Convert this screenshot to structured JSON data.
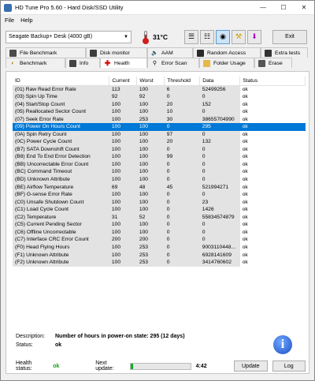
{
  "window": {
    "title": "HD Tune Pro 5.60 - Hard Disk/SSD Utility"
  },
  "menu": {
    "file": "File",
    "help": "Help"
  },
  "toolbar": {
    "drive": "Seagate Backup+  Desk (4000 gB)",
    "temperature": "31°C",
    "exit": "Exit"
  },
  "tabs_top": [
    "File Benchmark",
    "Disk monitor",
    "AAM",
    "Random Access",
    "Extra tests"
  ],
  "tabs_bottom": [
    "Benchmark",
    "Info",
    "Health",
    "Error Scan",
    "Folder Usage",
    "Erase"
  ],
  "table": {
    "headers": [
      "ID",
      "Current",
      "Worst",
      "Threshold",
      "Data",
      "Status"
    ],
    "rows": [
      [
        "(01) Raw Read Error Rate",
        "113",
        "100",
        "6",
        "52499256",
        "ok"
      ],
      [
        "(03) Spin Up Time",
        "92",
        "92",
        "0",
        "0",
        "ok"
      ],
      [
        "(04) Start/Stop Count",
        "100",
        "100",
        "20",
        "152",
        "ok"
      ],
      [
        "(05) Reallocated Sector Count",
        "100",
        "100",
        "10",
        "0",
        "ok"
      ],
      [
        "(07) Seek Error Rate",
        "100",
        "253",
        "30",
        "38655704990",
        "ok"
      ],
      [
        "(09) Power On Hours Count",
        "100",
        "100",
        "0",
        "295",
        "ok"
      ],
      [
        "(0A) Spin Retry Count",
        "100",
        "100",
        "97",
        "0",
        "ok"
      ],
      [
        "(0C) Power Cycle Count",
        "100",
        "100",
        "20",
        "132",
        "ok"
      ],
      [
        "(B7) SATA Downshift Count",
        "100",
        "100",
        "0",
        "0",
        "ok"
      ],
      [
        "(B8) End To End Error Detection",
        "100",
        "100",
        "99",
        "0",
        "ok"
      ],
      [
        "(BB) Uncorrectable Error Count",
        "100",
        "100",
        "0",
        "0",
        "ok"
      ],
      [
        "(BC) Command Timeout",
        "100",
        "100",
        "0",
        "0",
        "ok"
      ],
      [
        "(BD) Unknown Attribute",
        "100",
        "100",
        "0",
        "0",
        "ok"
      ],
      [
        "(BE) Airflow Temperature",
        "69",
        "48",
        "45",
        "521994271",
        "ok"
      ],
      [
        "(BF) G-sense Error Rate",
        "100",
        "100",
        "0",
        "0",
        "ok"
      ],
      [
        "(C0) Unsafe Shutdown Count",
        "100",
        "100",
        "0",
        "23",
        "ok"
      ],
      [
        "(C1) Load Cycle Count",
        "100",
        "100",
        "0",
        "1426",
        "ok"
      ],
      [
        "(C2) Temperature",
        "31",
        "52",
        "0",
        "55834574879",
        "ok"
      ],
      [
        "(C5) Current Pending Sector",
        "100",
        "100",
        "0",
        "0",
        "ok"
      ],
      [
        "(C6) Offline Uncorrectable",
        "100",
        "100",
        "0",
        "0",
        "ok"
      ],
      [
        "(C7) Interface CRC Error Count",
        "200",
        "200",
        "0",
        "0",
        "ok"
      ],
      [
        "(F0) Head Flying Hours",
        "100",
        "253",
        "0",
        "9003110448...",
        "ok"
      ],
      [
        "(F1) Unknown Attribute",
        "100",
        "253",
        "0",
        "6928141609",
        "ok"
      ],
      [
        "(F2) Unknown Attribute",
        "100",
        "253",
        "0",
        "3414760602",
        "ok"
      ]
    ],
    "selected_index": 5
  },
  "description": {
    "label": "Description:",
    "value": "Number of hours in power-on state: 295 (12 days)",
    "status_label": "Status:",
    "status_value": "ok"
  },
  "status": {
    "health_label": "Health status:",
    "health_value": "ok",
    "next_update_label": "Next update:",
    "progress_fraction": 0.04,
    "countdown": "4:42",
    "update_button": "Update",
    "log_button": "Log",
    "ok_color": "#1a9c1a",
    "progress_color": "#06b025"
  }
}
